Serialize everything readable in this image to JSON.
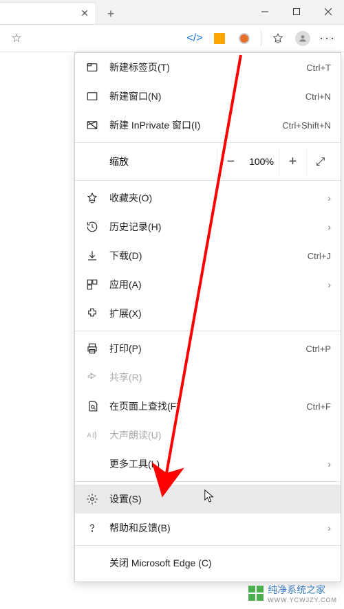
{
  "window": {
    "zoom": "100%"
  },
  "toolbar": {
    "more": "···"
  },
  "menu": {
    "newTab": {
      "label": "新建标签页(T)",
      "shortcut": "Ctrl+T"
    },
    "newWindow": {
      "label": "新建窗口(N)",
      "shortcut": "Ctrl+N"
    },
    "newInPrivate": {
      "label": "新建 InPrivate 窗口(I)",
      "shortcut": "Ctrl+Shift+N"
    },
    "zoomLabel": "缩放",
    "favorites": {
      "label": "收藏夹(O)"
    },
    "history": {
      "label": "历史记录(H)"
    },
    "downloads": {
      "label": "下载(D)",
      "shortcut": "Ctrl+J"
    },
    "apps": {
      "label": "应用(A)"
    },
    "extensions": {
      "label": "扩展(X)"
    },
    "print": {
      "label": "打印(P)",
      "shortcut": "Ctrl+P"
    },
    "share": {
      "label": "共享(R)"
    },
    "find": {
      "label": "在页面上查找(F)",
      "shortcut": "Ctrl+F"
    },
    "readAloud": {
      "label": "大声朗读(U)"
    },
    "moreTools": {
      "label": "更多工具(L)"
    },
    "settings": {
      "label": "设置(S)"
    },
    "help": {
      "label": "帮助和反馈(B)"
    },
    "closeEdge": {
      "label": "关闭 Microsoft Edge (C)"
    }
  },
  "watermark": {
    "brand": "纯净系统之家",
    "url": "WWW.YCWJZY.COM"
  }
}
